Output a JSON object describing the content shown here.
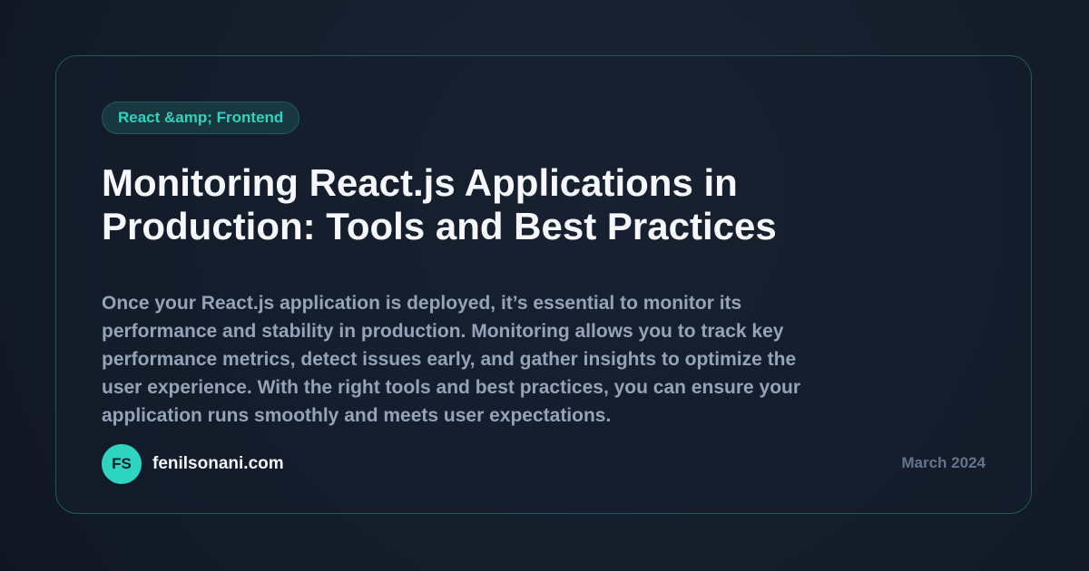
{
  "card": {
    "category": "React &amp; Frontend",
    "title": "Monitoring React.js Applications in Production: Tools and Best Practices",
    "description": "Once your React.js application is deployed, it’s essential to monitor its performance and stability in production. Monitoring allows you to track key performance metrics, detect issues early, and gather insights to optimize the user experience. With the right tools and best practices, you can ensure your application runs smoothly and meets user expectations.",
    "author_initials": "FS",
    "site": "fenilsonani.com",
    "date": "March 2024"
  },
  "colors": {
    "accent": "#2dd4bf",
    "background": "#151d2b",
    "border": "#1f5a59",
    "title": "#f5f7fa",
    "body_text": "#94a3b8",
    "muted": "#64748b"
  }
}
